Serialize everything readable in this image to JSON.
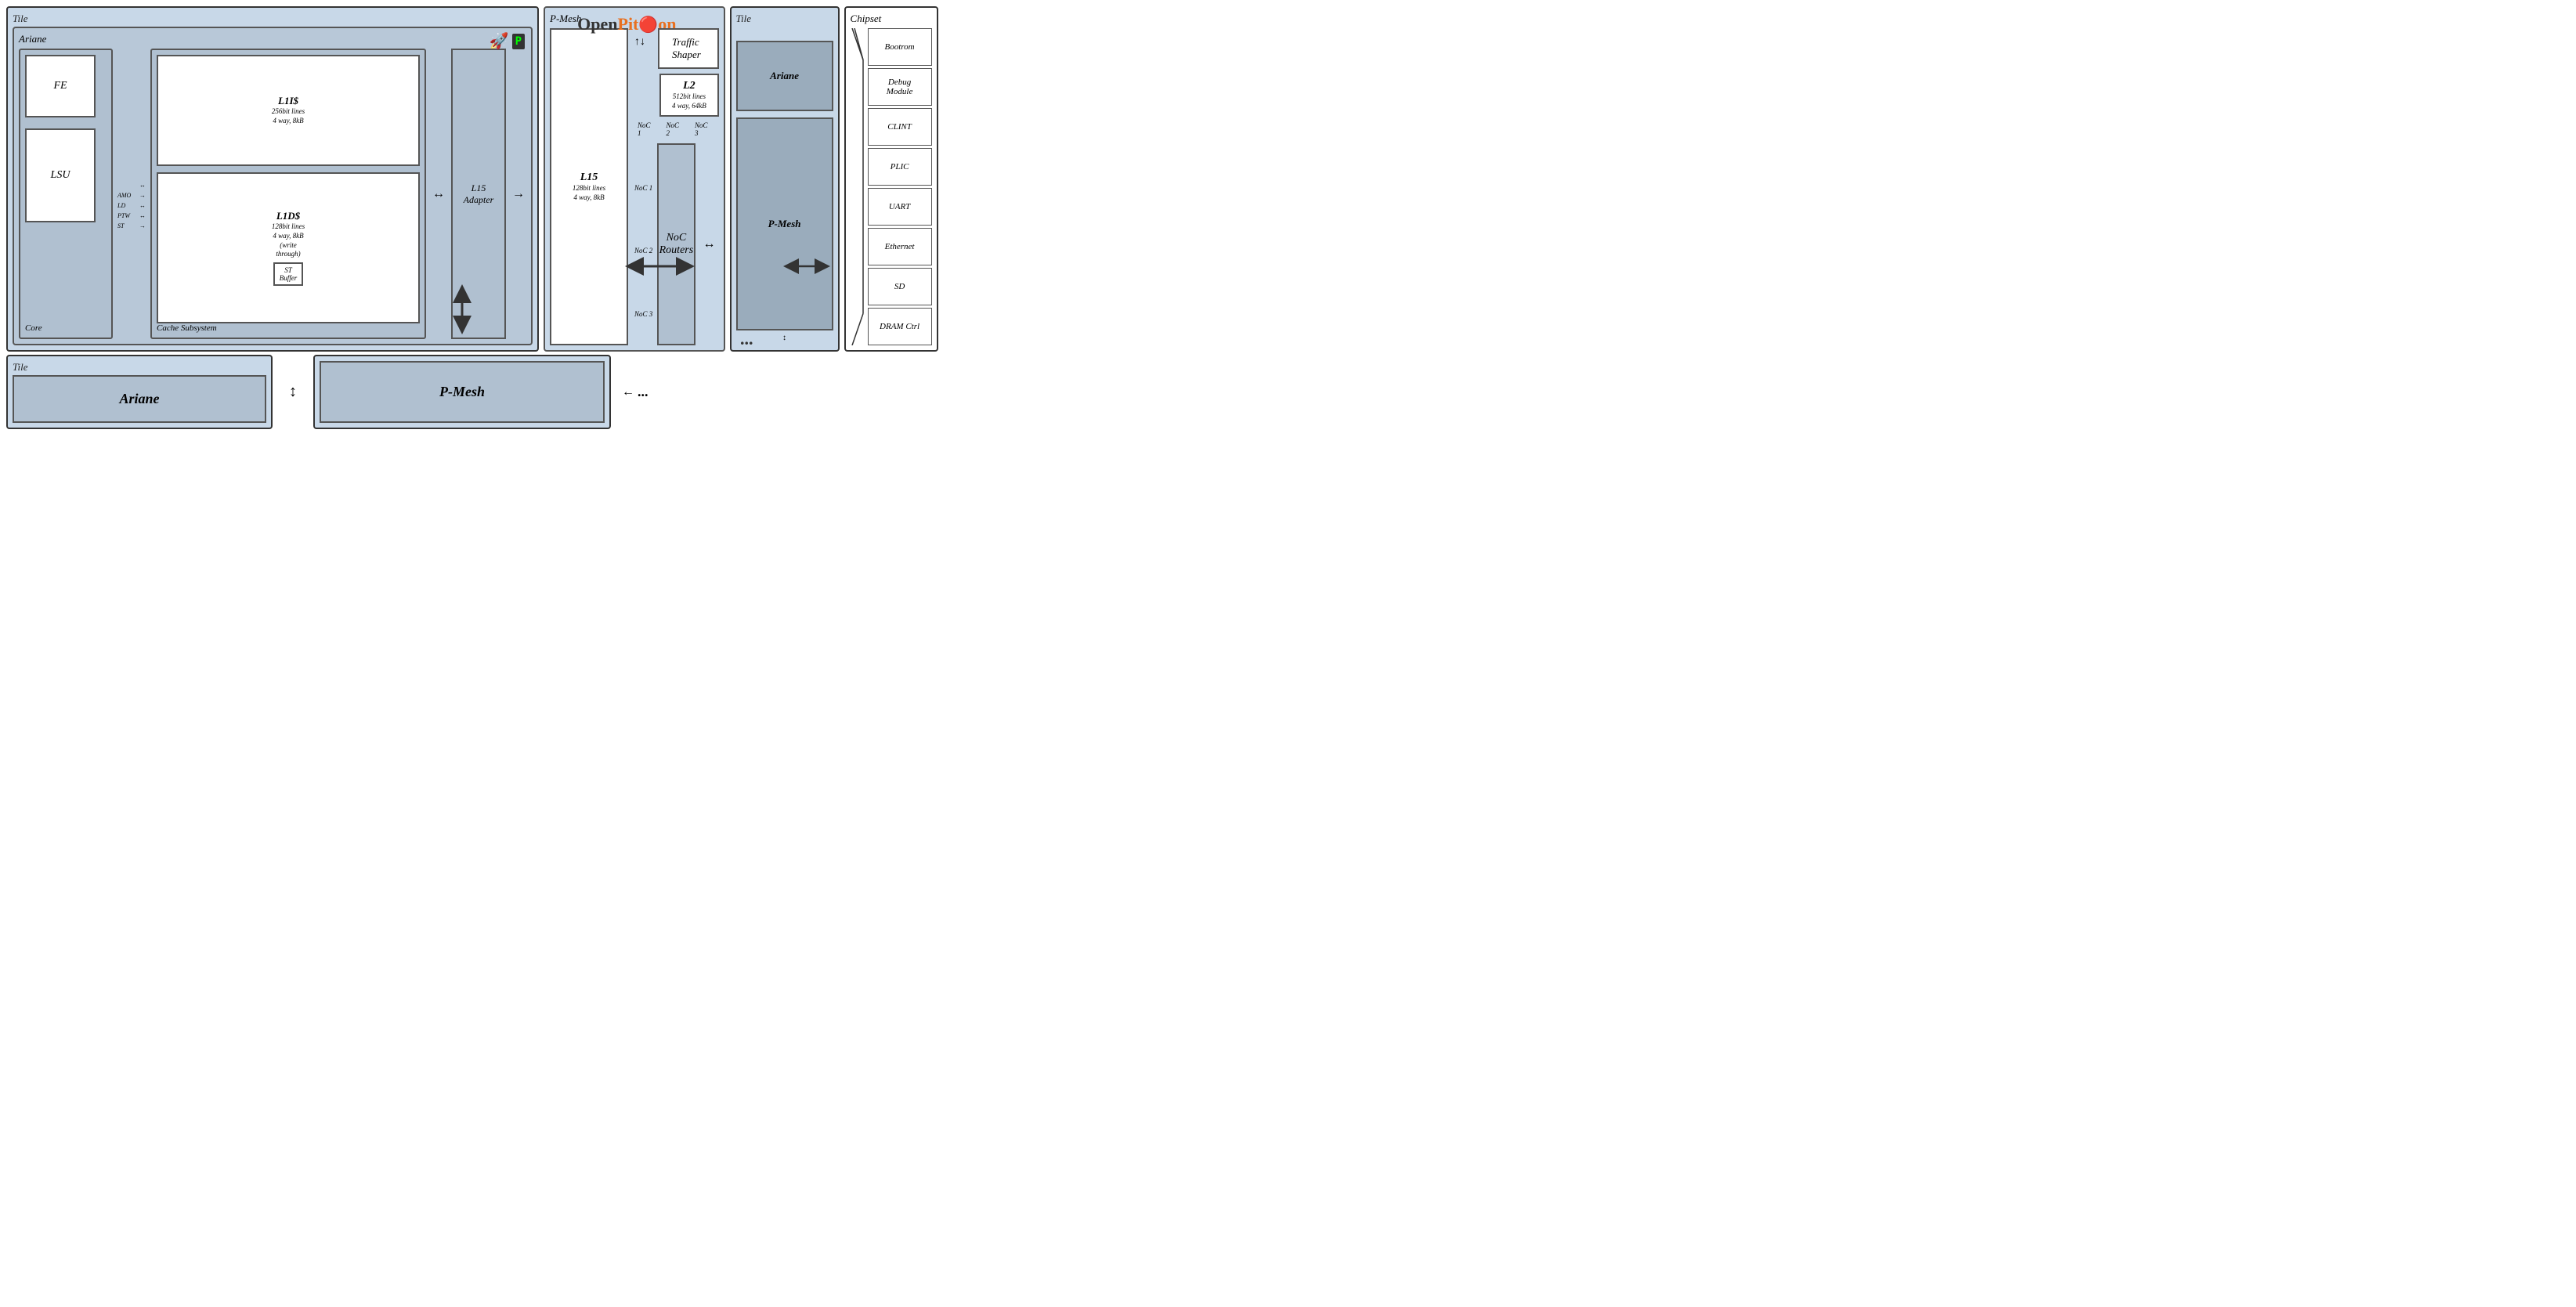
{
  "tiles": {
    "main_tile_label": "Tile",
    "ariane_label": "Ariane",
    "pmesh_label": "P-Mesh",
    "core_label": "Core",
    "cache_subsystem_label": "Cache Subsystem",
    "right_tile_label": "Tile",
    "chipset_label": "Chipset",
    "bottom_left_tile_label": "Tile",
    "bottom_ariane_label": "Ariane",
    "bottom_pmesh_label": "P-Mesh"
  },
  "core_components": {
    "fe_label": "FE",
    "lsu_label": "LSU"
  },
  "cache_components": {
    "l1i_label": "L1I$",
    "l1i_sub": "256bit lines\n4 way, 8kB",
    "l1d_label": "L1D$",
    "l1d_sub": "128bit lines\n4 way, 8kB\n(write\nthrough)",
    "st_buffer_label": "ST\nBuffer",
    "l15_adapter_label": "L15\nAdapter",
    "amo_label": "AMO",
    "ld_label": "LD",
    "ptw_label": "PTW",
    "st_label": "ST"
  },
  "pmesh_components": {
    "l15_label": "L15",
    "l15_sub": "128bit lines\n4 way, 8kB",
    "traffic_shaper_label": "Traffic Shaper",
    "l2_label": "L2",
    "l2_sub": "512bit lines\n4 way, 64kB",
    "noc_routers_label": "NoC\nRouters",
    "noc1_label": "NoC 1",
    "noc2_label": "NoC 2",
    "noc3_label": "NoC 3",
    "noc1_side_label": "NoC 1",
    "noc2_side_label": "NoC 2",
    "noc3_side_label": "NoC 3"
  },
  "right_tile": {
    "ariane_label": "Ariane",
    "pmesh_label": "P-Mesh"
  },
  "chipset_items": [
    "Bootrom",
    "Debug\nModule",
    "CLINT",
    "PLIC",
    "UART",
    "Ethernet",
    "SD",
    "DRAM Ctrl"
  ],
  "logo": {
    "open": "Open",
    "pit": "Pit",
    "on": "on"
  },
  "dots_label": "..."
}
